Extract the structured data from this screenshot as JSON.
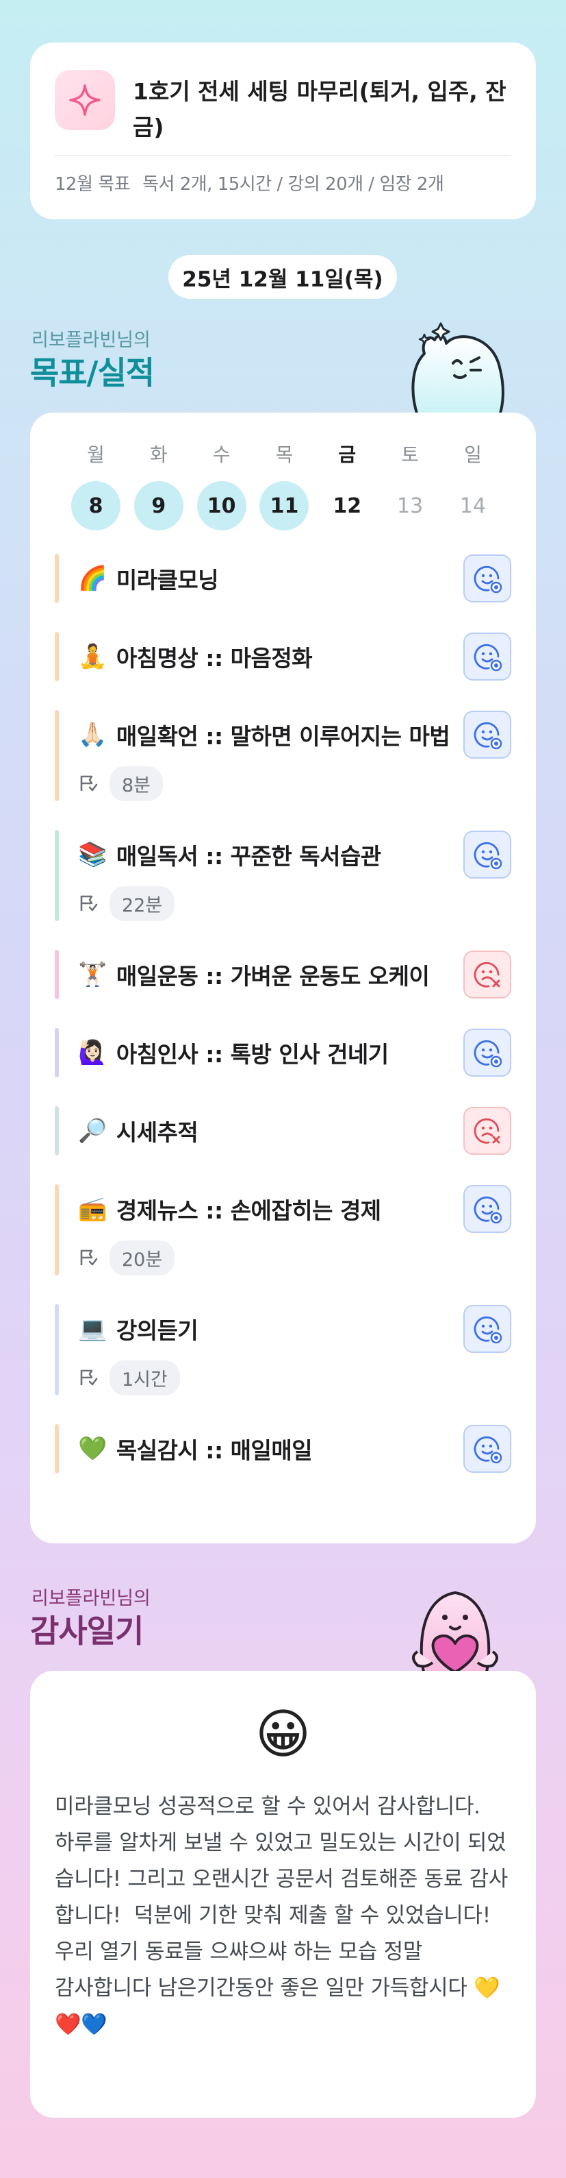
{
  "goal": {
    "title": "1호기 전세 세팅 마무리(퇴거, 입주, 잔금)",
    "meta_label": "12월 목표",
    "meta_value": "독서 2개, 15시간 / 강의 20개 / 임장 2개",
    "icon": "sparkle-icon"
  },
  "date_label": "25년 12월 11일(목)",
  "goals_section": {
    "subtitle": "리보플라빈님의",
    "title": "목표/실적"
  },
  "week": [
    {
      "dow": "월",
      "num": "8",
      "state": "done"
    },
    {
      "dow": "화",
      "num": "9",
      "state": "done"
    },
    {
      "dow": "수",
      "num": "10",
      "state": "done"
    },
    {
      "dow": "목",
      "num": "11",
      "state": "done"
    },
    {
      "dow": "금",
      "num": "12",
      "state": "today"
    },
    {
      "dow": "토",
      "num": "13",
      "state": "future"
    },
    {
      "dow": "일",
      "num": "14",
      "state": "future"
    }
  ],
  "tasks": [
    {
      "emoji": "🌈",
      "name": "미라클모닝",
      "status": "ok",
      "bar": "#f9d8b4",
      "extra": null
    },
    {
      "emoji": "🧘",
      "name": "아침명상 :: 마음정화",
      "status": "ok",
      "bar": "#f9d8b4",
      "extra": null
    },
    {
      "emoji": "🙏🏻",
      "name": "매일확언 :: 말하면 이루어지는 마법",
      "status": "ok",
      "bar": "#f9d8b4",
      "extra": "8분"
    },
    {
      "emoji": "📚",
      "name": "매일독서 :: 꾸준한 독서습관",
      "status": "ok",
      "bar": "#bfead9",
      "extra": "22분"
    },
    {
      "emoji": "🏋🏻",
      "name": "매일운동 :: 가벼운 운동도 오케이",
      "status": "fail",
      "bar": "#f6c4dc",
      "extra": null
    },
    {
      "emoji": "🙋🏻‍♀️",
      "name": "아침인사 :: 톡방 인사 건네기",
      "status": "ok",
      "bar": "#d6d2f2",
      "extra": null
    },
    {
      "emoji": "🔎",
      "name": "시세추적",
      "status": "fail",
      "bar": "#cfe3e3",
      "extra": null
    },
    {
      "emoji": "📻",
      "name": "경제뉴스 :: 손에잡히는 경제",
      "status": "ok",
      "bar": "#f9d8b4",
      "extra": "20분"
    },
    {
      "emoji": "💻",
      "name": "강의듣기",
      "status": "ok",
      "bar": "#cfdcf3",
      "extra": "1시간"
    },
    {
      "emoji": "💚",
      "name": "목실감시 :: 매일매일",
      "status": "ok",
      "bar": "#f9d8b4",
      "extra": null
    }
  ],
  "gratitude_section": {
    "subtitle": "리보플라빈님의",
    "title": "감사일기"
  },
  "gratitude": {
    "emoji": "😀",
    "text": "미라클모닝 성공적으로 할 수 있어서 감사합니다.\n하루를 알차게 보낼 수 있었고 밀도있는 시간이 되었습니다! 그리고 오랜시간 공문서 검토해준 동료 감사합니다!  덕분에 기한 맞춰 제출 할 수 있었습니다! 우리 열기 동료들 으쌰으쌰 하는 모습 정말\n감사합니다 남은기간동안 좋은 일만 가득합시다 💛❤️💙"
  },
  "colors": {
    "accent_teal": "#0e8f99",
    "accent_purple": "#7a2f6f",
    "ok_icon": "#3b6fe6",
    "fail_icon": "#e04b57"
  }
}
